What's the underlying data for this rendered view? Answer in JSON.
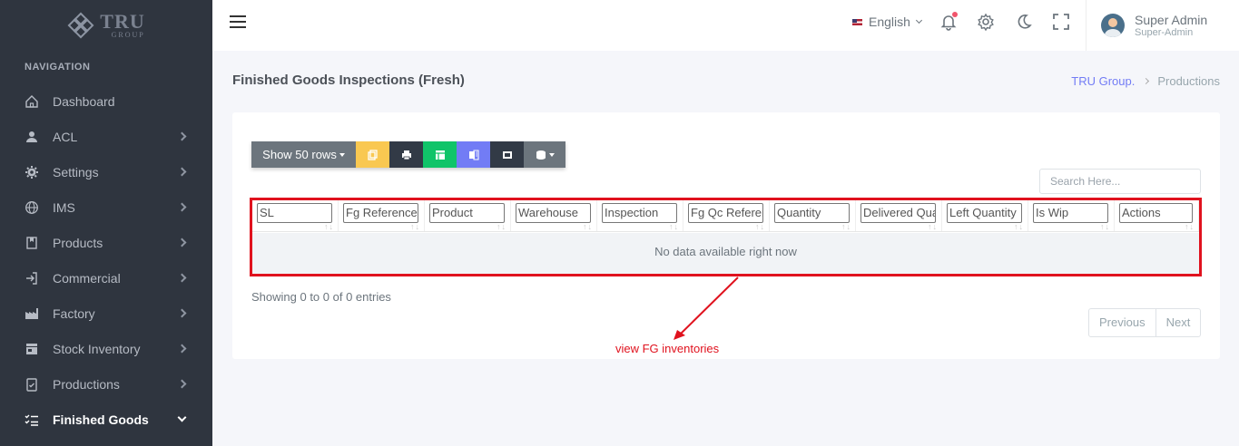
{
  "brand": {
    "name": "TRU",
    "sub": "GROUP"
  },
  "sidebar": {
    "heading": "NAVIGATION",
    "items": [
      {
        "label": "Dashboard",
        "icon": "home-icon",
        "chevron": false
      },
      {
        "label": "ACL",
        "icon": "user-shield-icon",
        "chevron": true
      },
      {
        "label": "Settings",
        "icon": "gear-icon",
        "chevron": true
      },
      {
        "label": "IMS",
        "icon": "globe-icon",
        "chevron": true
      },
      {
        "label": "Products",
        "icon": "bookmark-icon",
        "chevron": true
      },
      {
        "label": "Commercial",
        "icon": "sign-in-icon",
        "chevron": true
      },
      {
        "label": "Factory",
        "icon": "factory-icon",
        "chevron": true
      },
      {
        "label": "Stock Inventory",
        "icon": "store-icon",
        "chevron": true
      },
      {
        "label": "Productions",
        "icon": "clipboard-icon",
        "chevron": true
      },
      {
        "label": "Finished Goods",
        "icon": "list-check-icon",
        "chevron": true,
        "active": true
      }
    ]
  },
  "topbar": {
    "language": "English",
    "user": {
      "name": "Super Admin",
      "role": "Super-Admin"
    }
  },
  "page": {
    "title": "Finished Goods Inspections (Fresh)",
    "breadcrumb": [
      "TRU Group.",
      "Productions"
    ]
  },
  "toolbar": {
    "show_rows": "Show 50 rows",
    "buttons": [
      "copy-icon",
      "print-icon",
      "excel-icon",
      "csv-icon",
      "pdf-icon",
      "columns-icon"
    ],
    "colors": [
      "#f9c851",
      "#323a46",
      "#10c469",
      "#727cf5",
      "#323a46",
      "#6c757d"
    ]
  },
  "search": {
    "placeholder": "Search Here..."
  },
  "table": {
    "columns": [
      "SL",
      "Fg Reference",
      "Product",
      "Warehouse",
      "Inspection",
      "Fg Qc Reference",
      "Quantity",
      "Delivered Quantity",
      "Left Quantity",
      "Is Wip",
      "Actions"
    ],
    "empty_message": "No data available right now"
  },
  "footer": {
    "info": "Showing 0 to 0 of 0 entries",
    "previous": "Previous",
    "next": "Next"
  },
  "annotation": {
    "text": "view FG inventories",
    "color": "#e0121e"
  }
}
